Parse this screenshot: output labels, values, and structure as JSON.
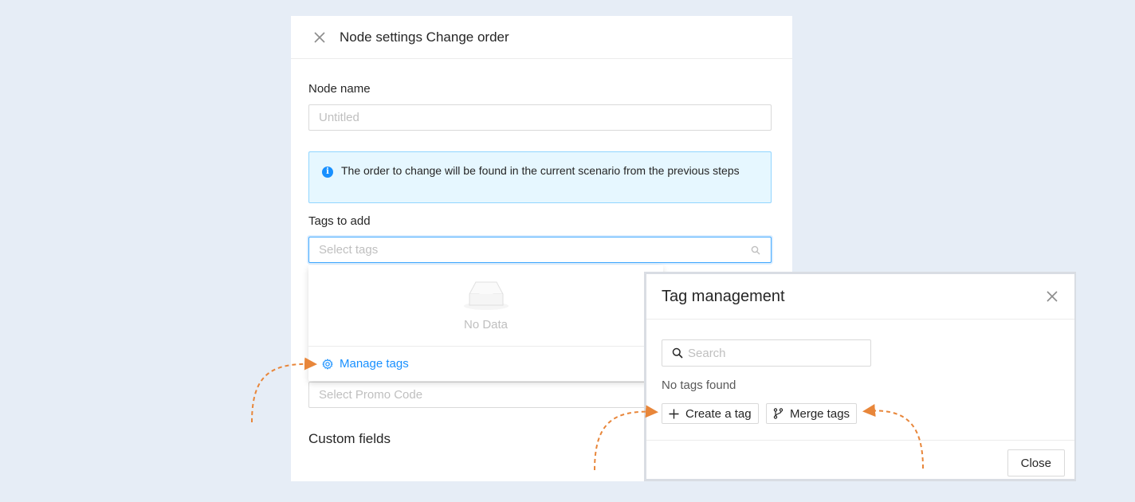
{
  "node_settings": {
    "title": "Node settings Change order",
    "node_name_label": "Node name",
    "node_name_placeholder": "Untitled",
    "info_message": "The order to change will be found in the current scenario from the previous steps",
    "tags_label": "Tags to add",
    "tags_placeholder": "Select tags",
    "promo_placeholder": "Select Promo Code",
    "custom_fields_title": "Custom fields"
  },
  "dropdown": {
    "empty_text": "No Data",
    "manage_tags_label": "Manage tags"
  },
  "tag_management": {
    "title": "Tag management",
    "search_placeholder": "Search",
    "no_tags_text": "No tags found",
    "create_label": "Create a tag",
    "merge_label": "Merge tags",
    "close_label": "Close"
  },
  "colors": {
    "background": "#e6edf6",
    "accent": "#1890ff",
    "info_bg": "#e6f7ff",
    "annotation_arrow": "#e8863a"
  }
}
